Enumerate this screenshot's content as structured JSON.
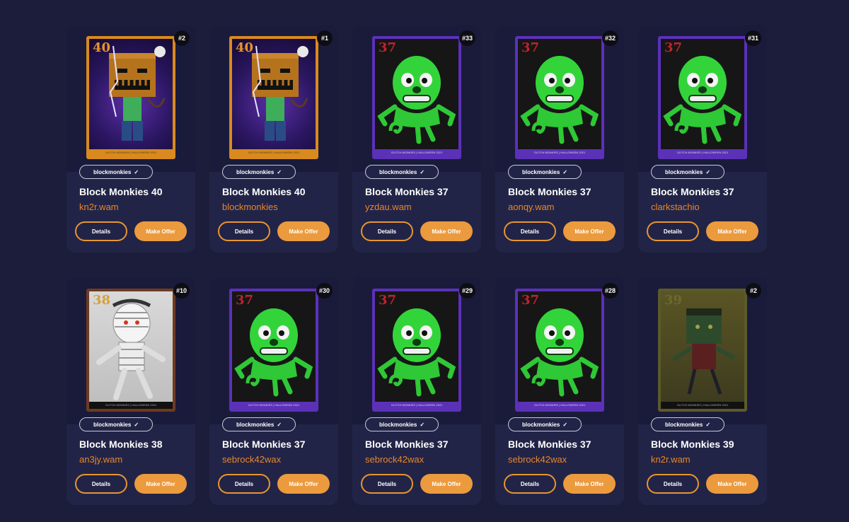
{
  "cards": [
    {
      "num": "#2",
      "collection": "blockmonkies",
      "title": "Block Monkies 40",
      "owner": "kn2r.wam",
      "art_number": "40",
      "art_style": "orange",
      "details_label": "Details",
      "offer_label": "Make Offer",
      "art_footer": "GLITCH MONKIES | HALLOWEEN 2021"
    },
    {
      "num": "#1",
      "collection": "blockmonkies",
      "title": "Block Monkies 40",
      "owner": "blockmonkies",
      "art_number": "40",
      "art_style": "orange",
      "details_label": "Details",
      "offer_label": "Make Offer",
      "art_footer": "GLITCH MONKIES | HALLOWEEN 2021"
    },
    {
      "num": "#33",
      "collection": "blockmonkies",
      "title": "Block Monkies 37",
      "owner": "yzdau.wam",
      "art_number": "37",
      "art_style": "purple",
      "details_label": "Details",
      "offer_label": "Make Offer",
      "art_footer": "GLITCH MONKIES | HALLOWEEN 2021"
    },
    {
      "num": "#32",
      "collection": "blockmonkies",
      "title": "Block Monkies 37",
      "owner": "aonqy.wam",
      "art_number": "37",
      "art_style": "purple",
      "details_label": "Details",
      "offer_label": "Make Offer",
      "art_footer": "GLITCH MONKIES | HALLOWEEN 2021"
    },
    {
      "num": "#31",
      "collection": "blockmonkies",
      "title": "Block Monkies 37",
      "owner": "clarkstachio",
      "art_number": "37",
      "art_style": "purple",
      "details_label": "Details",
      "offer_label": "Make Offer",
      "art_footer": "GLITCH MONKIES | HALLOWEEN 2021"
    },
    {
      "num": "#10",
      "collection": "blockmonkies",
      "title": "Block Monkies 38",
      "owner": "an3jy.wam",
      "art_number": "38",
      "art_style": "brown",
      "details_label": "Details",
      "offer_label": "Make Offer",
      "art_footer": "GLITCH MONKIES | HALLOWEEN 2021"
    },
    {
      "num": "#30",
      "collection": "blockmonkies",
      "title": "Block Monkies 37",
      "owner": "sebrock42wax",
      "art_number": "37",
      "art_style": "purple",
      "details_label": "Details",
      "offer_label": "Make Offer",
      "art_footer": "GLITCH MONKIES | HALLOWEEN 2021"
    },
    {
      "num": "#29",
      "collection": "blockmonkies",
      "title": "Block Monkies 37",
      "owner": "sebrock42wax",
      "art_number": "37",
      "art_style": "purple",
      "details_label": "Details",
      "offer_label": "Make Offer",
      "art_footer": "GLITCH MONKIES | HALLOWEEN 2021"
    },
    {
      "num": "#28",
      "collection": "blockmonkies",
      "title": "Block Monkies 37",
      "owner": "sebrock42wax",
      "art_number": "37",
      "art_style": "purple",
      "details_label": "Details",
      "offer_label": "Make Offer",
      "art_footer": "GLITCH MONKIES | HALLOWEEN 2021"
    },
    {
      "num": "#2",
      "collection": "blockmonkies",
      "title": "Block Monkies 39",
      "owner": "kn2r.wam",
      "art_number": "39",
      "art_style": "yellow",
      "details_label": "Details",
      "offer_label": "Make Offer",
      "art_footer": "GLITCH MONKIES | HALLOWEEN 2021"
    }
  ],
  "colors": {
    "background": "#1b1d3a",
    "card": "#222447",
    "accent": "#eb9a3d",
    "owner_text": "#e8862c"
  },
  "icons": {
    "verified": "check-icon"
  }
}
